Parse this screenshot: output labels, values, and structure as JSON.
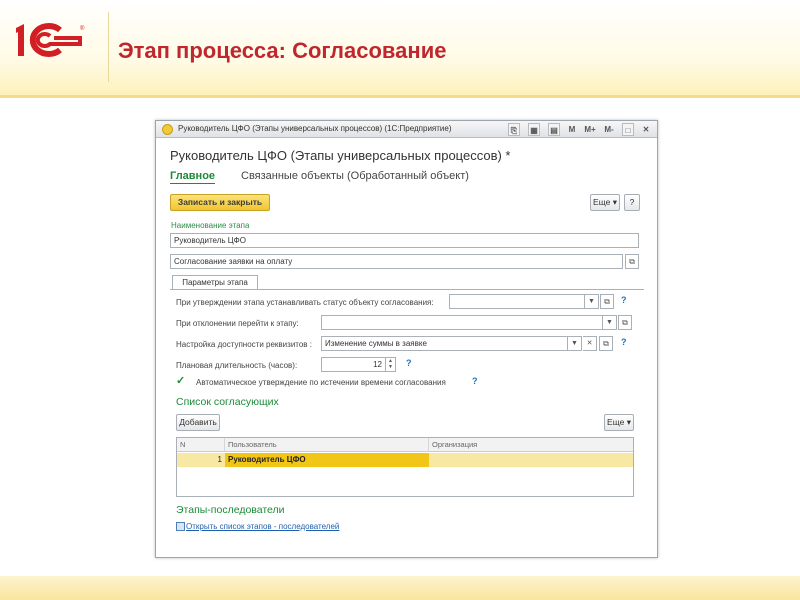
{
  "slide": {
    "title": "Этап процесса: Согласование",
    "logo_text": "1С"
  },
  "window": {
    "title": "Руководитель ЦФО (Этапы универсальных процессов) (1С:Предприятие)",
    "titlebar_buttons": [
      "M",
      "M+",
      "M-"
    ],
    "form_title": "Руководитель ЦФО (Этапы универсальных процессов) *",
    "nav": {
      "main": "Главное",
      "related": "Связанные объекты (Обработанный объект)"
    },
    "toolbar": {
      "save_close": "Записать и закрыть",
      "more": "Еще",
      "help": "?"
    },
    "stage_name_label": "Наименование этапа",
    "stage_name_value": "Руководитель ЦФО",
    "description_value": "Согласование заявки на оплату",
    "tab_label": "Параметры этапа",
    "params": {
      "status_label": "При утверждении этапа устанавливать статус объекту согласования:",
      "reject_label": "При отклонении перейти к этапу:",
      "access_label": "Настройка доступности реквизитов :",
      "access_value": "Изменение суммы в заявке",
      "duration_label": "Плановая длительность (часов):",
      "duration_value": "12",
      "auto_approve_label": "Автоматическое утверждение по истечении времени согласования",
      "help": "?"
    },
    "approvers": {
      "section_title": "Список согласующих",
      "add_button": "Добавить",
      "more_button": "Еще",
      "columns": [
        "N",
        "Пользователь",
        "Организация"
      ],
      "rows": [
        {
          "n": "1",
          "user": "Руководитель ЦФО",
          "org": ""
        }
      ]
    },
    "successors": {
      "section_title": "Этапы-последователи",
      "link": "Открыть список этапов - последователей"
    }
  },
  "colors": {
    "title_red": "#c0262d",
    "accent_green": "#1d8a3a",
    "selection_yellow": "#f2c616"
  }
}
